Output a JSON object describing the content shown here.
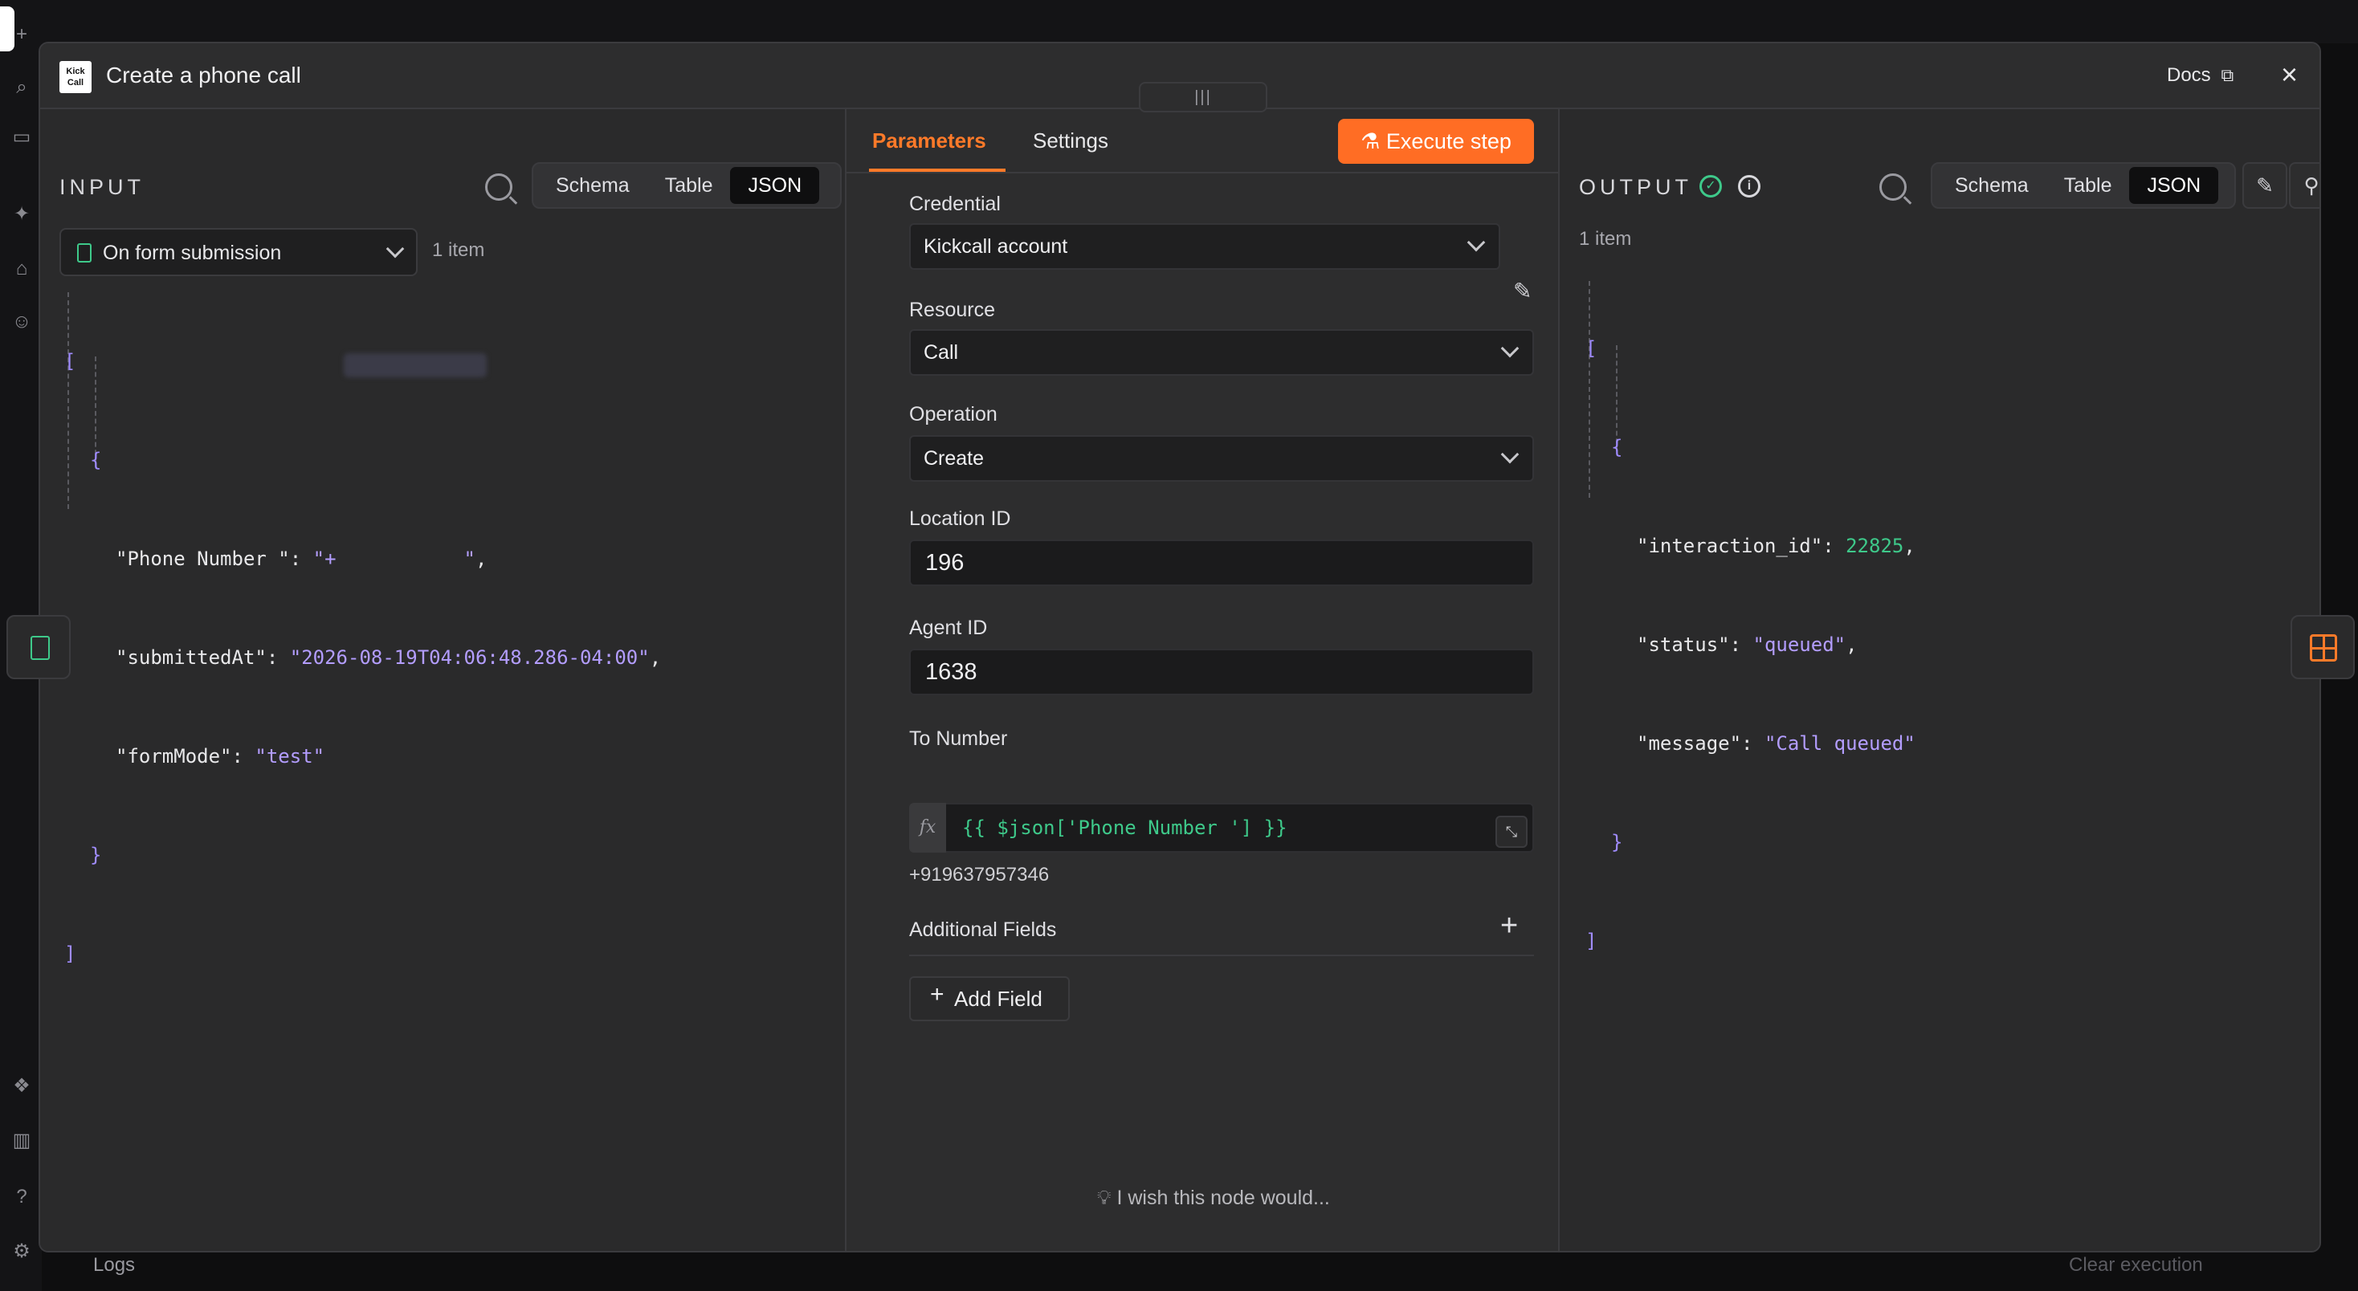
{
  "modal": {
    "title": "Create a phone call",
    "logo_text": "Kick Call",
    "docs_label": "Docs",
    "close_icon": "close-icon"
  },
  "background": {
    "logs_label": "Logs",
    "clear_execution_label": "Clear execution"
  },
  "input": {
    "label": "INPUT",
    "view_tabs": [
      "Schema",
      "Table",
      "JSON"
    ],
    "active_view": "JSON",
    "trigger_select": "On form submission",
    "item_count": "1 item",
    "json": {
      "open_bracket": "[",
      "open_brace": "{",
      "rows": [
        {
          "key": "\"Phone Number \"",
          "value": "\"+           \"",
          "comma": ","
        },
        {
          "key": "\"submittedAt\"",
          "value": "\"2026-08-19T04:06:48.286-04:00\"",
          "comma": ","
        },
        {
          "key": "\"formMode\"",
          "value": "\"test\"",
          "comma": ""
        }
      ],
      "close_brace": "}",
      "close_bracket": "]"
    }
  },
  "params": {
    "tabs": {
      "parameters": "Parameters",
      "settings": "Settings"
    },
    "execute_label": "Execute step",
    "credential": {
      "label": "Credential",
      "value": "Kickcall account"
    },
    "resource": {
      "label": "Resource",
      "value": "Call"
    },
    "operation": {
      "label": "Operation",
      "value": "Create"
    },
    "location_id": {
      "label": "Location ID",
      "value": "196"
    },
    "agent_id": {
      "label": "Agent ID",
      "value": "1638"
    },
    "to_number": {
      "label": "To Number",
      "fx": "fx",
      "expression": "{{ $json['Phone Number '] }}",
      "preview": "+919637957346"
    },
    "additional_fields": {
      "label": "Additional Fields",
      "plus": "+"
    },
    "add_field_label": "Add Field",
    "add_field_plus": "+",
    "wish_label": "I wish this node would..."
  },
  "output": {
    "label": "OUTPUT",
    "view_tabs": [
      "Schema",
      "Table",
      "JSON"
    ],
    "active_view": "JSON",
    "item_count": "1 item",
    "json": {
      "open_bracket": "[",
      "open_brace": "{",
      "rows": [
        {
          "key": "\"interaction_id\"",
          "value": "22825",
          "comma": ",",
          "type": "num"
        },
        {
          "key": "\"status\"",
          "value": "\"queued\"",
          "comma": ",",
          "type": "str"
        },
        {
          "key": "\"message\"",
          "value": "\"Call queued\"",
          "comma": "",
          "type": "str"
        }
      ],
      "close_brace": "}",
      "close_bracket": "]"
    }
  },
  "colors": {
    "accent": "#ff6d24",
    "success": "#3ec98a",
    "json_string": "#b39dff"
  }
}
